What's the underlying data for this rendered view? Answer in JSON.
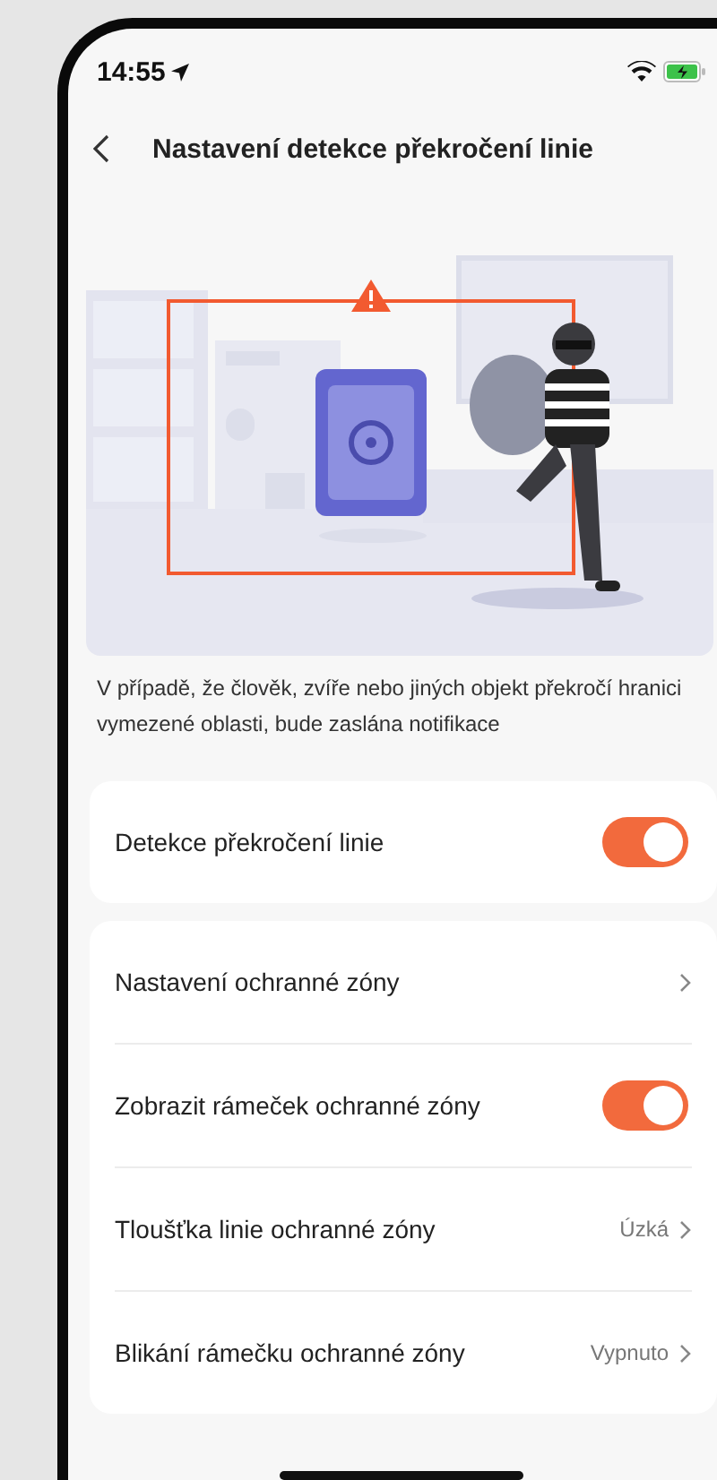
{
  "status_bar": {
    "time": "14:55"
  },
  "header": {
    "title": "Nastavení detekce překročení linie"
  },
  "description": "V případě, že člověk, zvíře nebo jiných objekt překročí hranici vymezené oblasti, bude zaslána notifikace",
  "groups": [
    {
      "rows": [
        {
          "kind": "toggle",
          "label": "Detekce překročení linie",
          "on": true
        }
      ]
    },
    {
      "rows": [
        {
          "kind": "link",
          "label": "Nastavení ochranné zóny"
        },
        {
          "kind": "toggle",
          "label": "Zobrazit rámeček ochranné zóny",
          "on": true
        },
        {
          "kind": "link",
          "label": "Tloušťka linie ochranné zóny",
          "value": "Úzká"
        },
        {
          "kind": "link",
          "label": "Blikání rámečku ochranné zóny",
          "value": "Vypnuto"
        }
      ]
    }
  ]
}
